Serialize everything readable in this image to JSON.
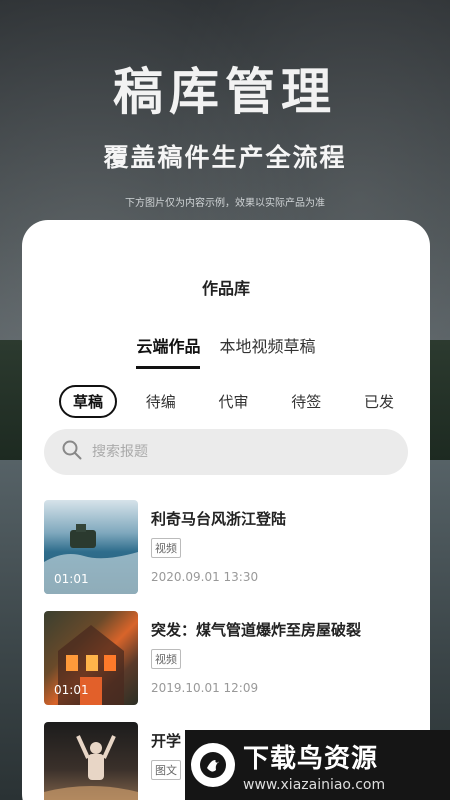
{
  "hero": {
    "title": "稿库管理",
    "subtitle": "覆盖稿件生产全流程",
    "notice": "下方图片仅为内容示例，效果以实际产品为准"
  },
  "card": {
    "title": "作品库",
    "tabs": [
      "云端作品",
      "本地视频草稿"
    ],
    "active_tab": "云端作品",
    "filters": [
      "草稿",
      "待编",
      "代审",
      "待签",
      "已发"
    ],
    "active_filter": "草稿",
    "search": {
      "placeholder": "搜索报题",
      "value": ""
    }
  },
  "items": [
    {
      "title": "利奇马台风浙江登陆",
      "tag": "视频",
      "date": "2020.09.01 13:30",
      "duration": "01:01"
    },
    {
      "title": "突发：煤气管道爆炸至房屋破裂",
      "tag": "视频",
      "date": "2019.10.01 12:09",
      "duration": "01:01"
    },
    {
      "title": "开学",
      "tag": "图文",
      "date": "",
      "duration": ""
    }
  ],
  "watermark": {
    "title": "下载鸟资源",
    "url": "www.xiazainiao.com"
  },
  "colors": {
    "accent": "#111111",
    "search_bg": "#ebebeb",
    "card_bg": "#ffffff"
  }
}
